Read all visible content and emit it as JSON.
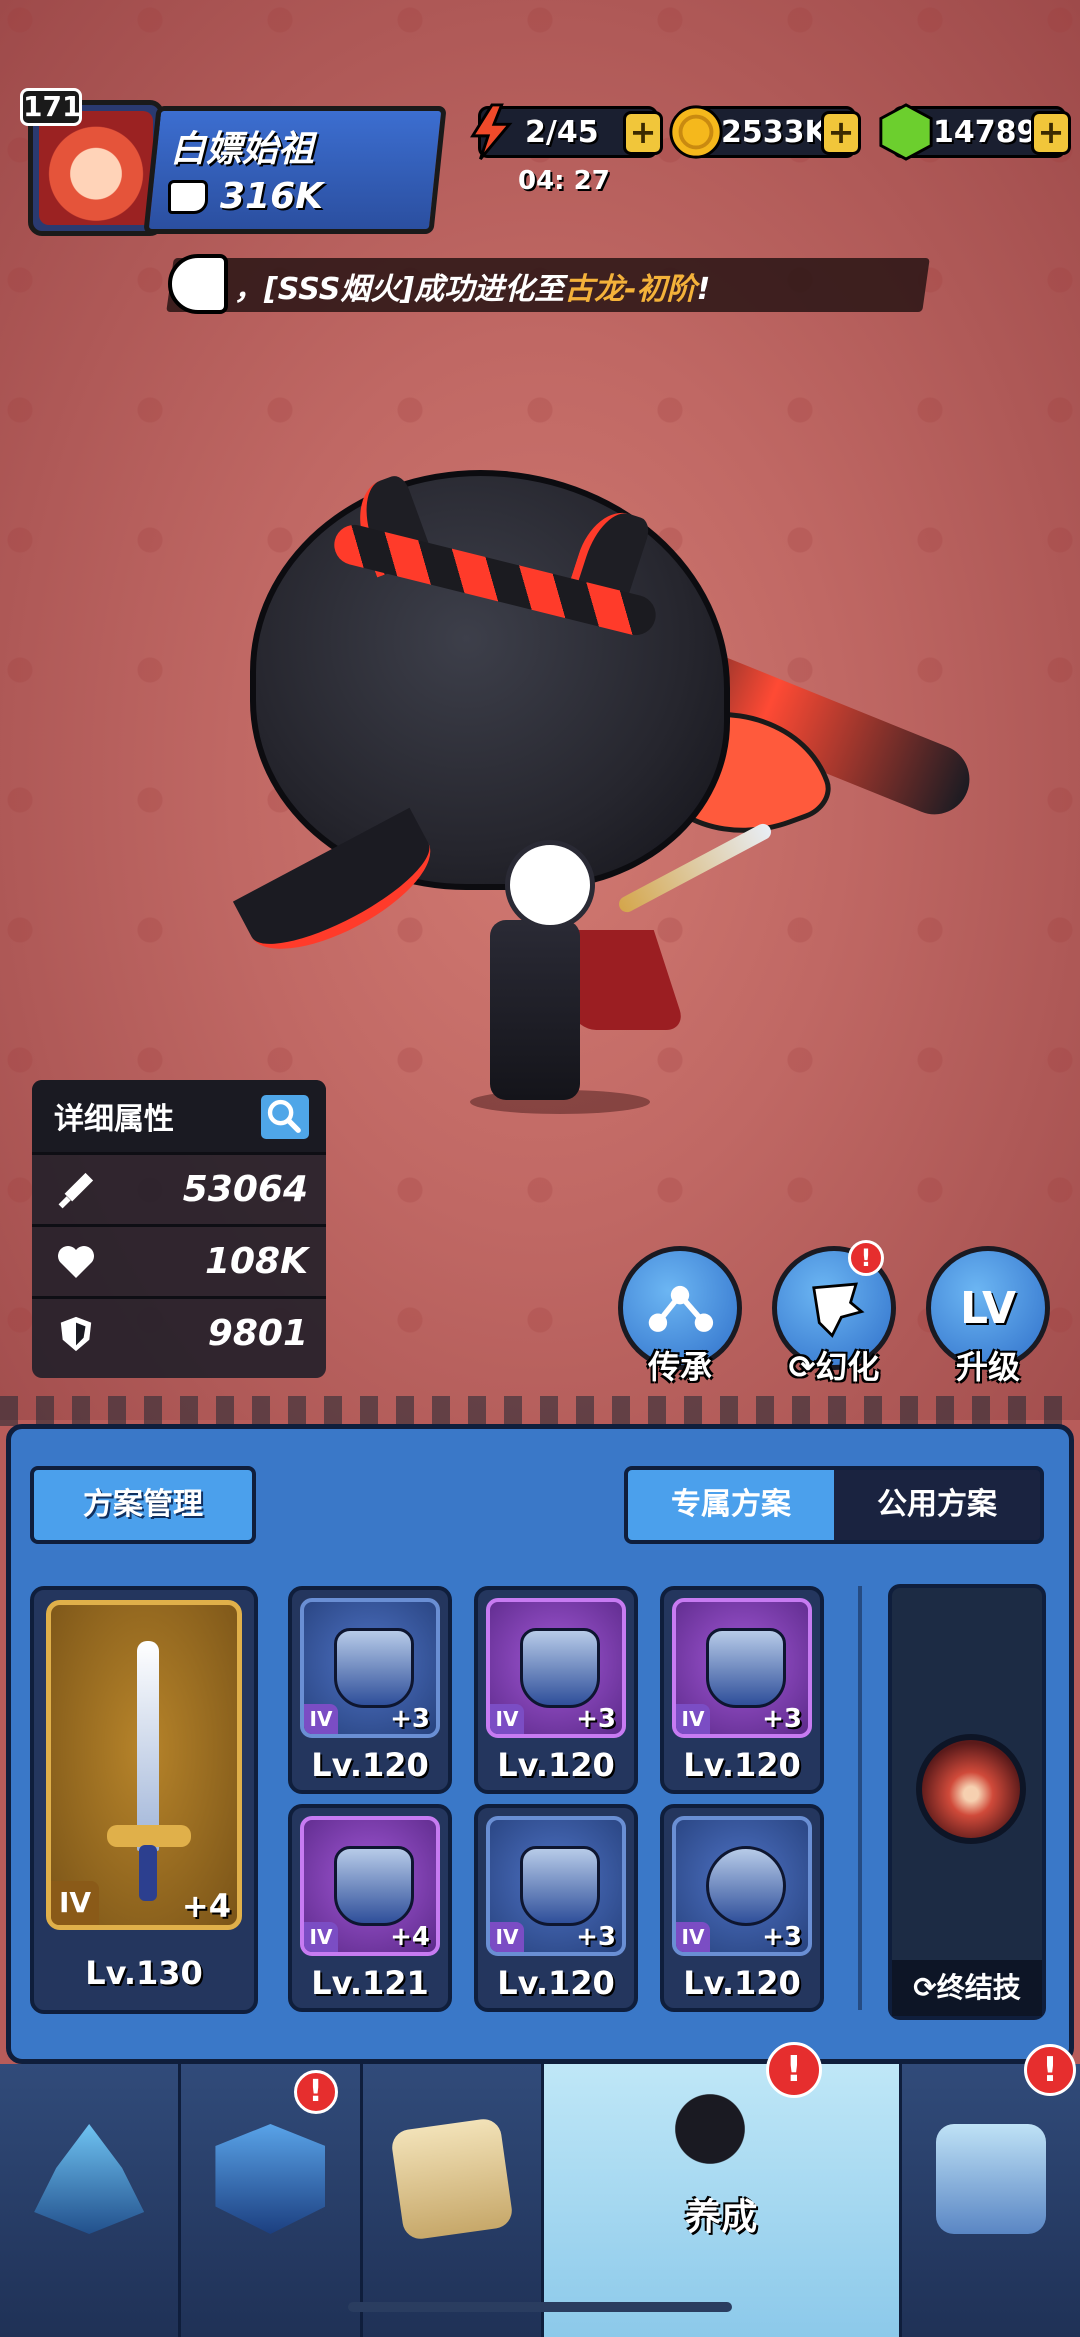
{
  "player": {
    "level": "171",
    "name": "白嫖始祖",
    "power": "316K"
  },
  "resources": {
    "energy": "2/45",
    "energy_timer": "04: 27",
    "gold": "2533K",
    "gems": "14789",
    "plus": "+"
  },
  "broadcast": {
    "prefix": "，[SSS烟火]成功进化至",
    "highlight": "古龙-初阶",
    "suffix": "!"
  },
  "stats": {
    "title": "详细属性",
    "attack": "53064",
    "hp": "108K",
    "defense": "9801"
  },
  "actions": {
    "inherit": "传承",
    "transform": "幻化",
    "upgrade": "升级",
    "upgrade_glyph": "LV",
    "alert": "!"
  },
  "loadout": {
    "manage_label": "方案管理",
    "tabs": [
      "专属方案",
      "公用方案"
    ],
    "weapon": {
      "tier": "IV",
      "plus": "+4",
      "level": "Lv.130"
    },
    "gear": [
      {
        "tier": "IV",
        "plus": "+3",
        "level": "Lv.120",
        "rarity": "rare"
      },
      {
        "tier": "IV",
        "plus": "+3",
        "level": "Lv.120",
        "rarity": "epic"
      },
      {
        "tier": "IV",
        "plus": "+3",
        "level": "Lv.120",
        "rarity": "epic"
      },
      {
        "tier": "IV",
        "plus": "+4",
        "level": "Lv.121",
        "rarity": "epic"
      },
      {
        "tier": "IV",
        "plus": "+3",
        "level": "Lv.120",
        "rarity": "rare"
      },
      {
        "tier": "IV",
        "plus": "+3",
        "level": "Lv.120",
        "rarity": "rare"
      }
    ],
    "ultimate_label": "终结技"
  },
  "nav": {
    "active_label": "养成"
  },
  "colors": {
    "accent_blue": "#4ba0ec",
    "panel_blue": "#3a78c8",
    "gold": "#f1c63a",
    "highlight": "#f4b23a",
    "alert_red": "#e62e2e"
  }
}
